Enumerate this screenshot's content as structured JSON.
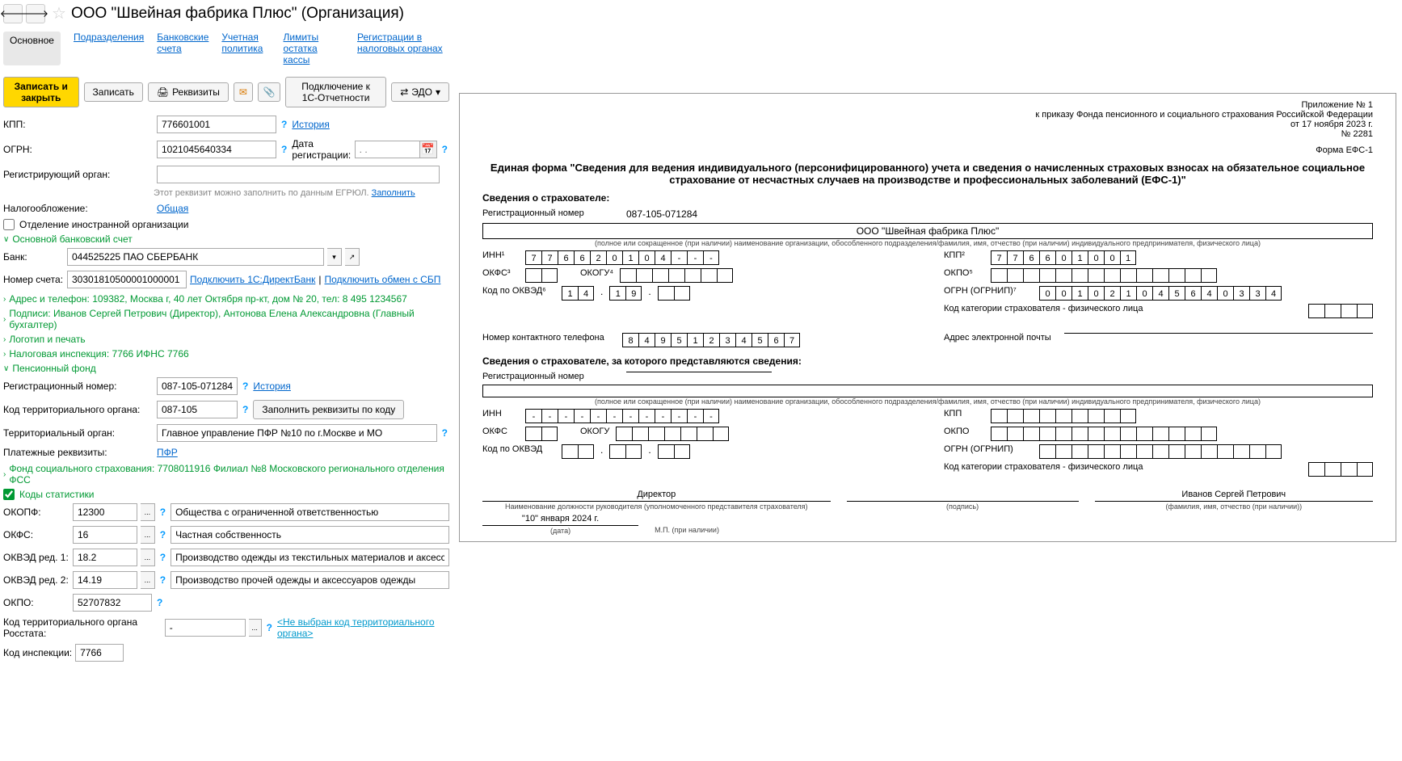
{
  "title": "ООО \"Швейная фабрика Плюс\" (Организация)",
  "tabs": {
    "main": "Основное",
    "subdiv": "Подразделения",
    "bank": "Банковские счета",
    "policy": "Учетная политика",
    "limits": "Лимиты остатка кассы",
    "tax_reg": "Регистрации в налоговых органах"
  },
  "toolbar": {
    "save_close": "Записать и закрыть",
    "save": "Записать",
    "requisites": "Реквизиты",
    "connect_1c": "Подключение к 1С-Отчетности",
    "edo": "ЭДО"
  },
  "form": {
    "kpp_label": "КПП:",
    "kpp": "776601001",
    "history": "История",
    "ogrn_label": "ОГРН:",
    "ogrn": "1021045640334",
    "reg_date_label": "Дата регистрации:",
    "reg_date_placeholder": ". .",
    "reg_org_label": "Регистрирующий орган:",
    "hint": "Этот реквизит можно заполнить по данным ЕГРЮЛ.",
    "fill": "Заполнить",
    "tax_label": "Налогообложение:",
    "tax": "Общая",
    "foreign_branch": "Отделение иностранной организации",
    "main_bank_section": "Основной банковский счет",
    "bank_label": "Банк:",
    "bank": "044525225 ПАО СБЕРБАНК",
    "account_label": "Номер счета:",
    "account": "30301810500001000001",
    "connect_direct": "Подключить 1С:ДиректБанк",
    "connect_sbp": "Подключить обмен с СБП",
    "address_section": "Адрес и телефон: 109382, Москва г, 40 лет Октября пр-кт, дом № 20, тел: 8 495 1234567",
    "signatures_section": "Подписи: Иванов Сергей Петрович (Директор), Антонова Елена Александровна (Главный бухгалтер)",
    "logo_section": "Логотип и печать",
    "tax_insp_section": "Налоговая инспекция: 7766 ИФНС 7766",
    "pension_section": "Пенсионный фонд",
    "reg_num_label": "Регистрационный номер:",
    "reg_num": "087-105-071284",
    "terr_code_label": "Код территориального органа:",
    "terr_code": "087-105",
    "fill_by_code": "Заполнить реквизиты по коду",
    "terr_org_label": "Территориальный орган:",
    "terr_org": "Главное управление ПФР №10 по г.Москве и МО",
    "payment_label": "Платежные реквизиты:",
    "payment": "ПФР",
    "fss_section": "Фонд социального страхования: 7708011916 Филиал №8 Московского регионального отделения ФСС",
    "stats_section": "Коды статистики",
    "okopf_label": "ОКОПФ:",
    "okopf": "12300",
    "okopf_desc": "Общества с ограниченной ответственностью",
    "okfs_label": "ОКФС:",
    "okfs": "16",
    "okfs_desc": "Частная собственность",
    "okved1_label": "ОКВЭД ред. 1:",
    "okved1": "18.2",
    "okved1_desc": "Производство одежды из текстильных материалов и аксессуаров о",
    "okved2_label": "ОКВЭД ред. 2:",
    "okved2": "14.19",
    "okved2_desc": "Производство прочей одежды и аксессуаров одежды",
    "okpo_label": "ОКПО:",
    "okpo": "52707832",
    "rosstat_code_label": "Код территориального органа Росстата:",
    "rosstat_code": "-",
    "rosstat_hint": "<Не выбран код территориального органа>",
    "insp_code_label": "Код инспекции:",
    "insp_code": "7766"
  },
  "doc": {
    "appendix": "Приложение № 1",
    "decree": "к приказу Фонда пенсионного и социального страхования Российской Федерации",
    "date_decree": "от 17 ноября 2023 г.",
    "num": "№ 2281",
    "form_label": "Форма ЕФС-1",
    "title": "Единая форма \"Сведения для ведения индивидуального (персонифицированного) учета и сведения о начисленных страховых взносах на обязательное социальное страхование от несчастных случаев на производстве и профессиональных заболеваний (ЕФС-1)\"",
    "insurer_section": "Сведения о страхователе:",
    "reg_num_label": "Регистрационный номер",
    "reg_num": "087-105-071284",
    "org_name": "ООО \"Швейная фабрика Плюс\"",
    "name_hint": "(полное или сокращенное (при наличии) наименование организации, обособленного подразделения/фамилия, имя, отчество (при наличии) индивидуального предпринимателя, физического лица)",
    "inn_label": "ИНН¹",
    "inn": [
      "7",
      "7",
      "6",
      "6",
      "2",
      "0",
      "1",
      "0",
      "4",
      "-",
      "-",
      "-"
    ],
    "kpp_label": "КПП²",
    "kpp": [
      "7",
      "7",
      "6",
      "6",
      "0",
      "1",
      "0",
      "0",
      "1"
    ],
    "okfs_label": "ОКФС³",
    "okogu_label": "ОКОГУ⁴",
    "okpo_label": "ОКПО⁵",
    "okved_label": "Код по ОКВЭД⁶",
    "okved_1": [
      "1",
      "4"
    ],
    "okved_2": [
      "1",
      "9"
    ],
    "ogrn_label": "ОГРН (ОГРНИП)⁷",
    "ogrn": [
      "0",
      "0",
      "1",
      "0",
      "2",
      "1",
      "0",
      "4",
      "5",
      "6",
      "4",
      "0",
      "3",
      "3",
      "4"
    ],
    "cat_code_label": "Код категории страхователя - физического лица",
    "phone_label": "Номер контактного телефона",
    "phone": [
      "8",
      "4",
      "9",
      "5",
      "1",
      "2",
      "3",
      "4",
      "5",
      "6",
      "7"
    ],
    "email_label": "Адрес электронной почты",
    "insurer2_section": "Сведения о страхователе, за которого представляются сведения:",
    "reg_num2_label": "Регистрационный номер",
    "inn2_label": "ИНН",
    "inn2": [
      "-",
      "-",
      "-",
      "-",
      "-",
      "-",
      "-",
      "-",
      "-",
      "-",
      "-",
      "-"
    ],
    "kpp2_label": "КПП",
    "okfs2_label": "ОКФС",
    "okogu2_label": "ОКОГУ",
    "okpo2_label": "ОКПО",
    "okved2_label": "Код по ОКВЭД",
    "ogrn2_label": "ОГРН (ОГРНИП)",
    "cat_code2_label": "Код категории страхователя - физического лица",
    "director": "Директор",
    "director_hint": "Наименование должности руководителя (уполномоченного представителя страхователя)",
    "signature_hint": "(подпись)",
    "fio": "Иванов Сергей Петрович",
    "fio_hint": "(фамилия, имя, отчество (при наличии))",
    "sign_date": "\"10\" января 2024 г.",
    "date_hint": "(дата)",
    "mp": "М.П. (при наличии)"
  }
}
